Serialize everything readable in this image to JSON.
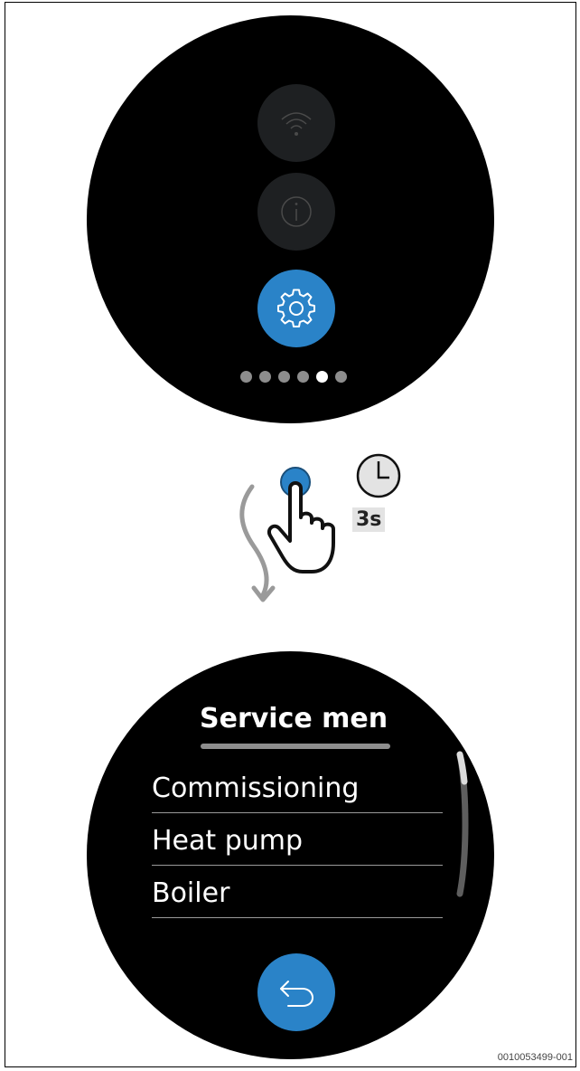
{
  "top_screen": {
    "icons": [
      "wifi-icon",
      "info-icon",
      "gear-icon"
    ],
    "selected_icon": "gear-icon",
    "page_indicator": {
      "total": 6,
      "active_index": 4
    }
  },
  "gesture": {
    "action": "press-and-hold",
    "duration_label": "3s"
  },
  "service_menu": {
    "title": "Service menu",
    "items": [
      "Commissioning",
      "Heat pump",
      "Boiler"
    ],
    "back_button": "back-icon"
  },
  "caption": "0010053499-001",
  "colors": {
    "accent_blue": "#2a83c8",
    "screen_background": "#000000",
    "dim_button": "#1e2022"
  }
}
